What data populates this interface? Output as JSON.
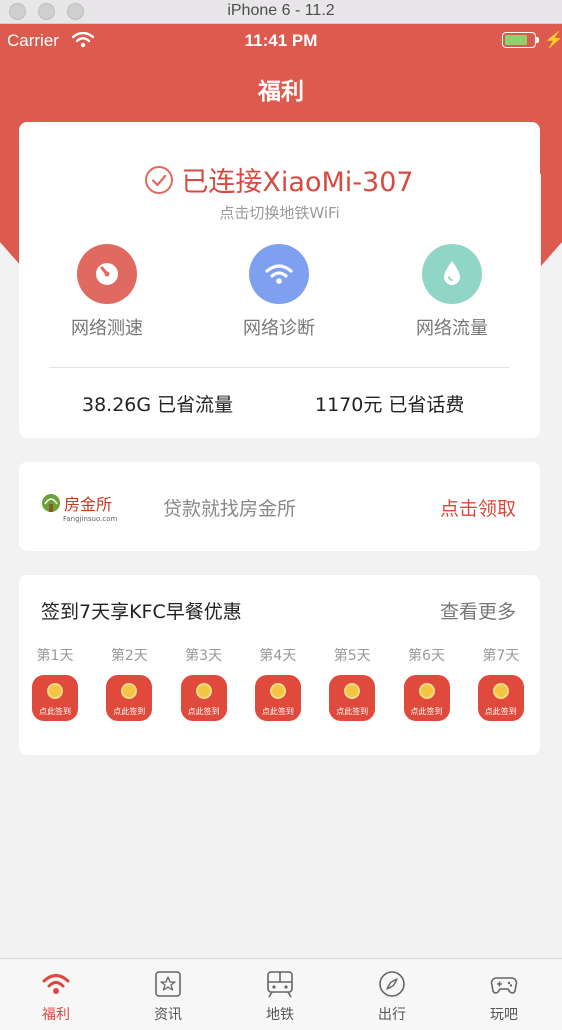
{
  "simulator": {
    "title": "iPhone 6 - 11.2"
  },
  "status_bar": {
    "carrier": "Carrier",
    "time": "11:41 PM"
  },
  "nav": {
    "title": "福利"
  },
  "connection": {
    "title": "已连接XiaoMi-307",
    "subtitle": "点击切换地铁WiFi"
  },
  "tools": [
    {
      "label": "网络测速",
      "icon": "speedometer-icon",
      "color": "#e06a5f"
    },
    {
      "label": "网络诊断",
      "icon": "wifi-icon",
      "color": "#7fa0ef"
    },
    {
      "label": "网络流量",
      "icon": "water-drop-icon",
      "color": "#8fd6c6"
    }
  ],
  "stats": {
    "data_saved": "38.26G 已省流量",
    "fee_saved": "1170元 已省话费"
  },
  "ad": {
    "logo_text": "房金所",
    "logo_sub": "Fangjinsuo.com",
    "text": "贷款就找房金所",
    "action": "点击领取"
  },
  "signin": {
    "title": "签到7天享KFC早餐优惠",
    "more": "查看更多",
    "button_label": "点此签到",
    "days": [
      "第1天",
      "第2天",
      "第3天",
      "第4天",
      "第5天",
      "第6天",
      "第7天"
    ]
  },
  "tabbar": {
    "items": [
      {
        "label": "福利",
        "icon": "wifi-tab-icon",
        "active": true
      },
      {
        "label": "资讯",
        "icon": "star-box-icon",
        "active": false
      },
      {
        "label": "地铁",
        "icon": "train-icon",
        "active": false
      },
      {
        "label": "出行",
        "icon": "compass-icon",
        "active": false
      },
      {
        "label": "玩吧",
        "icon": "gamepad-icon",
        "active": false
      }
    ]
  },
  "colors": {
    "brand_red": "#dc5a4e",
    "accent_text_red": "#d94a3e",
    "background": "#f2f2f2"
  }
}
